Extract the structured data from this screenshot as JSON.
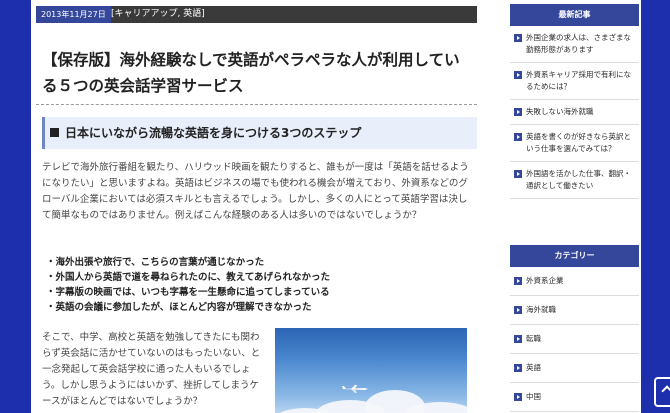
{
  "post": {
    "date": "2013年11月27日",
    "categories": "[キャリアアップ, 英語]",
    "title": "【保存版】海外経験なしで英語がペラペラな人が利用している５つの英会話学習サービス",
    "heading": "日本にいながら流暢な英語を身につける3つのステップ",
    "paragraph1": "テレビで海外旅行番組を観たり、ハリウッド映画を観たりすると、誰もが一度は「英語を話せるようになりたい」と思いますよね。英語はビジネスの場でも使われる機会が増えており、外資系などのグローバル企業においては必須スキルとも言えるでしょう。しかし、多くの人にとって英語学習は決して簡単なものではありません。例えばこんな経験のある人は多いのではないでしょうか？",
    "bullets": [
      "・海外出張や旅行で、こちらの言葉が通じなかった",
      "・外国人から英語で道を尋ねられたのに、教えてあげられなかった",
      "・字幕版の映画では、いつも字幕を一生懸命に追ってしまっている",
      "・英語の会議に参加したが、ほとんど内容が理解できなかった"
    ],
    "paragraph2": "そこで、中学、高校と英語を勉強してきたにも関わらず英会話に活かせていないのはもったいない、と一念発起して英会話学校に通った人もいるでしょう。しかし思うようにはいかず、挫折してしまうケースがほとんどではないでしょうか？"
  },
  "sidebar": {
    "recent": {
      "title": "最新記事",
      "items": [
        "外国企業の求人は、さまざまな勤務形態があります",
        "外資系キャリア採用で有利になるためには？",
        "失敗しない海外就職",
        "英語を書くのが好きなら英訳という仕事を選んでみては？",
        "外国語を活かした仕事、翻訳・通訳として働きたい"
      ]
    },
    "categories": {
      "title": "カテゴリー",
      "items": [
        "外資系企業",
        "海外就職",
        "転職",
        "英語",
        "中国"
      ]
    }
  },
  "colors": {
    "background": "#1e2fae",
    "accent": "#34479a",
    "meta_bar": "#3a3a3a",
    "heading_bg": "#e8eefa"
  }
}
